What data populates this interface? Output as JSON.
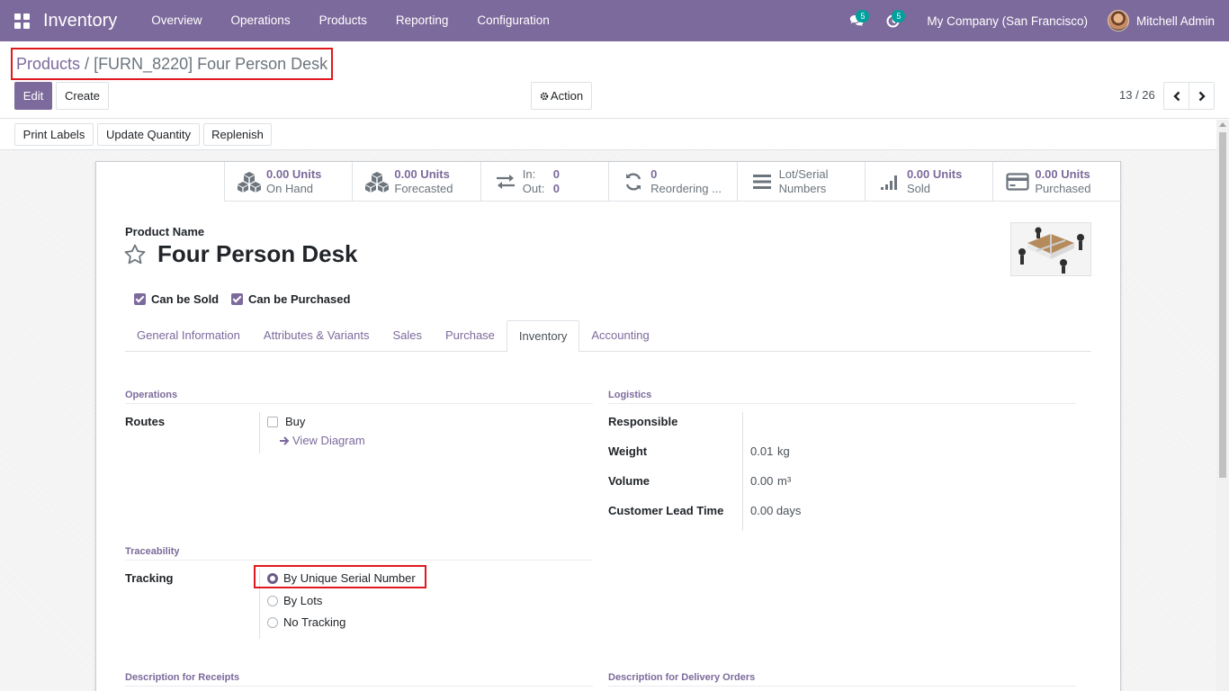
{
  "navbar": {
    "app_title": "Inventory",
    "menu": [
      "Overview",
      "Operations",
      "Products",
      "Reporting",
      "Configuration"
    ],
    "messages_count": "5",
    "activities_count": "5",
    "company": "My Company (San Francisco)",
    "user": "Mitchell Admin"
  },
  "breadcrumb": {
    "parent": "Products",
    "separator": "/",
    "current": "[FURN_8220] Four Person Desk"
  },
  "control": {
    "edit_label": "Edit",
    "create_label": "Create",
    "action_label": "Action",
    "pager": "13 / 26"
  },
  "statusbar": {
    "print_labels": "Print Labels",
    "update_quantity": "Update Quantity",
    "replenish": "Replenish"
  },
  "smart_buttons": {
    "on_hand_value": "0.00 Units",
    "on_hand_label": "On Hand",
    "forecasted_value": "0.00 Units",
    "forecasted_label": "Forecasted",
    "in_label": "In:",
    "in_value": "0",
    "out_label": "Out:",
    "out_value": "0",
    "reordering_value": "0",
    "reordering_label": "Reordering ...",
    "lots_label_1": "Lot/Serial",
    "lots_label_2": "Numbers",
    "sold_value": "0.00 Units",
    "sold_label": "Sold",
    "purchased_value": "0.00 Units",
    "purchased_label": "Purchased"
  },
  "product": {
    "name_label": "Product Name",
    "name": "Four Person Desk",
    "can_be_sold": "Can be Sold",
    "can_be_purchased": "Can be Purchased"
  },
  "tabs": [
    "General Information",
    "Attributes & Variants",
    "Sales",
    "Purchase",
    "Inventory",
    "Accounting"
  ],
  "operations": {
    "title": "Operations",
    "routes_label": "Routes",
    "buy_label": "Buy",
    "view_diagram": "View Diagram"
  },
  "logistics": {
    "title": "Logistics",
    "responsible_label": "Responsible",
    "weight_label": "Weight",
    "weight_value": "0.01",
    "weight_unit": "kg",
    "volume_label": "Volume",
    "volume_value": "0.00",
    "volume_unit": "m³",
    "lead_time_label": "Customer Lead Time",
    "lead_time_value": "0.00 days"
  },
  "traceability": {
    "title": "Traceability",
    "tracking_label": "Tracking",
    "options": [
      "By Unique Serial Number",
      "By Lots",
      "No Tracking"
    ]
  },
  "descriptions": {
    "receipts": "Description for Receipts",
    "delivery": "Description for Delivery Orders"
  }
}
